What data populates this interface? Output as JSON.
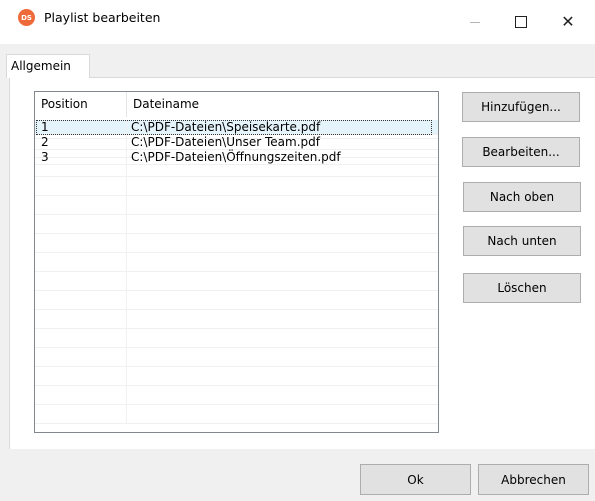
{
  "window": {
    "title": "Playlist bearbeiten",
    "icon_text": "DS"
  },
  "tabs": [
    {
      "label": "Allgemein",
      "active": true
    }
  ],
  "table": {
    "columns": [
      "Position",
      "Dateiname"
    ],
    "rows": [
      {
        "position": "1",
        "filename": "C:\\PDF-Dateien\\Speisekarte.pdf",
        "selected": true
      },
      {
        "position": "2",
        "filename": "C:\\PDF-Dateien\\Unser Team.pdf",
        "selected": false
      },
      {
        "position": "3",
        "filename": "C:\\PDF-Dateien\\Öffnungszeiten.pdf",
        "selected": false
      }
    ]
  },
  "side_buttons": {
    "add": "Hinzufügen...",
    "edit": "Bearbeiten...",
    "up": "Nach oben",
    "down": "Nach unten",
    "delete": "Löschen"
  },
  "footer": {
    "ok": "Ok",
    "cancel": "Abbrechen"
  },
  "colors": {
    "selection": "#e5f3fb",
    "button_face": "#e1e1e1",
    "dialog_bg": "#f0f0f0",
    "app_icon": "#ef6a3a"
  }
}
